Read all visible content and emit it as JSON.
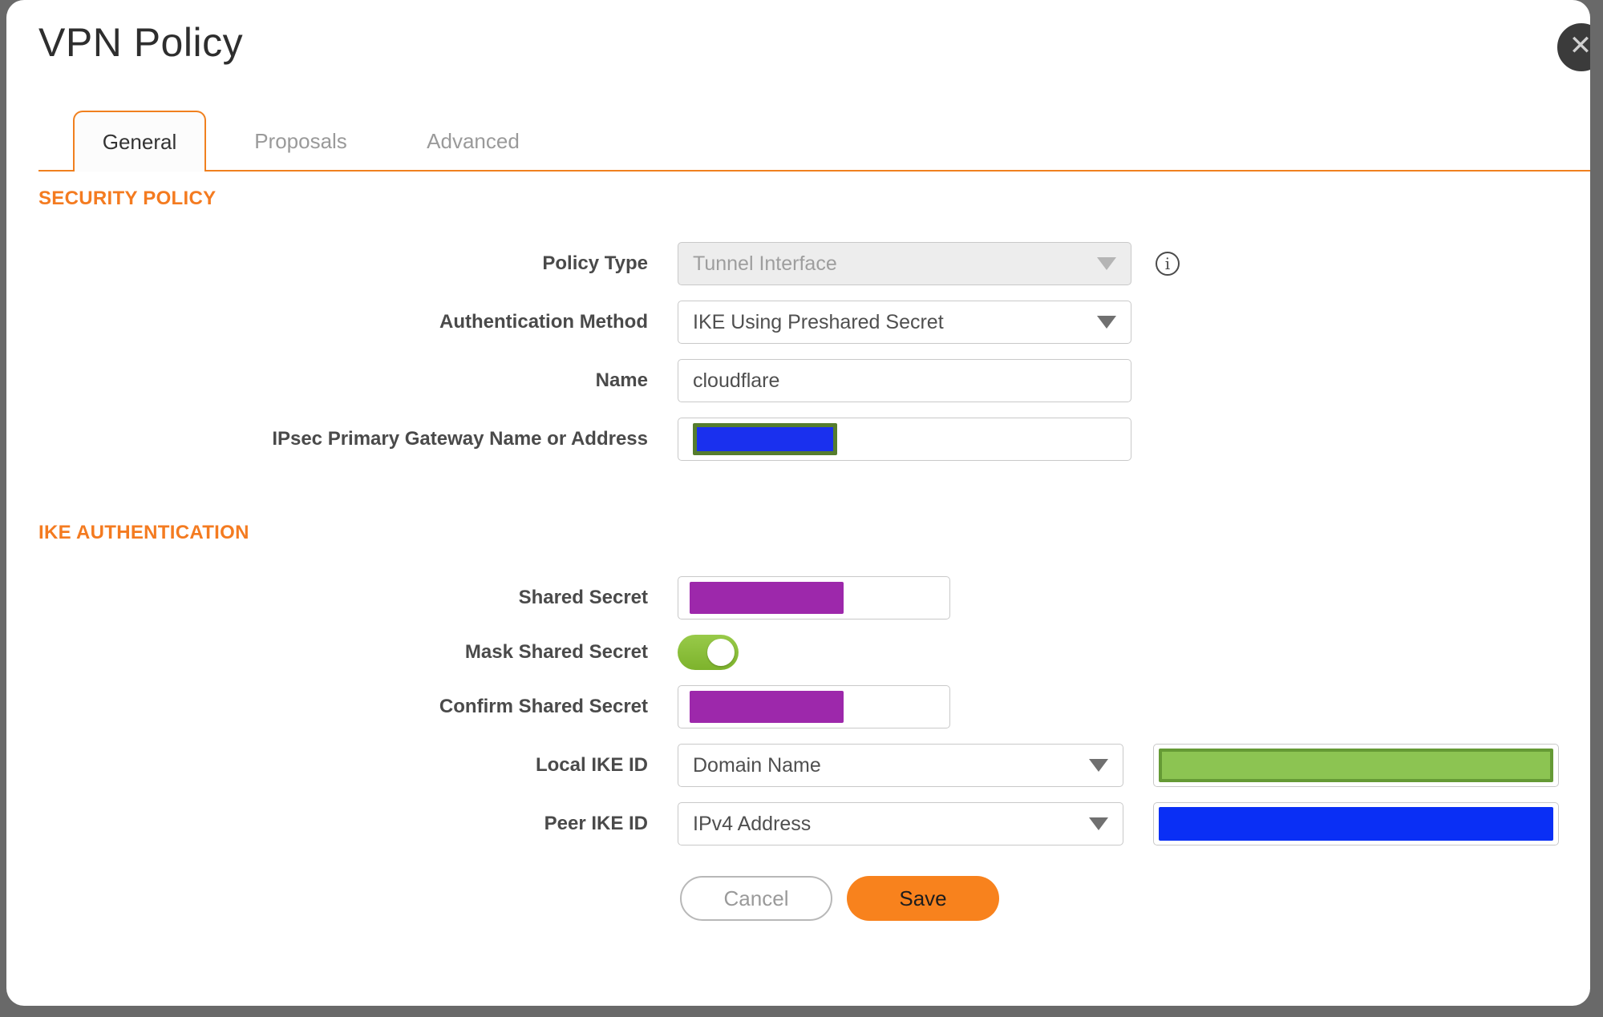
{
  "dialog": {
    "title": "VPN Policy",
    "close_glyph": "✕"
  },
  "tabs": [
    {
      "label": "General",
      "active": true
    },
    {
      "label": "Proposals",
      "active": false
    },
    {
      "label": "Advanced",
      "active": false
    }
  ],
  "sections": {
    "security_policy": "SECURITY POLICY",
    "ike_authentication": "IKE AUTHENTICATION"
  },
  "fields": {
    "policy_type": {
      "label": "Policy Type",
      "value": "Tunnel Interface",
      "disabled": true
    },
    "auth_method": {
      "label": "Authentication Method",
      "value": "IKE Using Preshared Secret"
    },
    "name": {
      "label": "Name",
      "value": "cloudflare"
    },
    "gateway": {
      "label": "IPsec Primary Gateway Name or Address",
      "value_redacted": "blue"
    },
    "shared_secret": {
      "label": "Shared Secret",
      "value_redacted": "purple"
    },
    "mask_shared_secret": {
      "label": "Mask Shared Secret",
      "enabled": true
    },
    "confirm_shared_secret": {
      "label": "Confirm Shared Secret",
      "value_redacted": "purple"
    },
    "local_ike_id": {
      "label": "Local IKE ID",
      "value": "Domain Name",
      "side_value_redacted": "green"
    },
    "peer_ike_id": {
      "label": "Peer IKE ID",
      "value": "IPv4 Address",
      "side_value_redacted": "blue"
    }
  },
  "info_icon_glyph": "i",
  "buttons": {
    "cancel": "Cancel",
    "save": "Save"
  },
  "colors": {
    "accent_orange": "#f47b20",
    "save_orange": "#f8821d",
    "toggle_green": "#84c32a",
    "redaction_purple": "#9d28ab",
    "redaction_blue": "#1a30ee",
    "redaction_blue_peer": "#0a2ff5",
    "redaction_green": "#8cc452",
    "redaction_green_border": "#659a35",
    "redaction_olive_border": "#567d2e",
    "backdrop_gray": "#696969",
    "close_button_bg": "#3b3b3b"
  }
}
